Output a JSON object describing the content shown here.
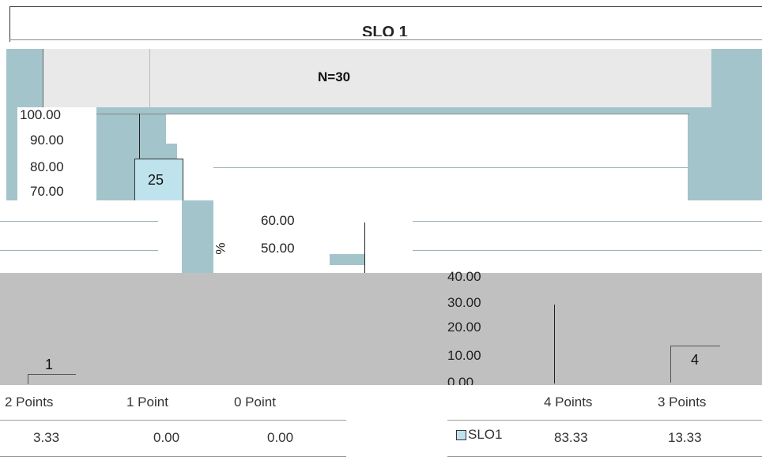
{
  "chart_data": {
    "type": "bar",
    "title": "SLO 1",
    "subtitle": "N=30",
    "ylabel": "%",
    "ylim": [
      0,
      100
    ],
    "y_ticks": [
      "100.00",
      "90.00",
      "80.00",
      "70.00",
      "60.00",
      "50.00",
      "40.00",
      "30.00",
      "20.00",
      "10.00",
      "0.00"
    ],
    "categories": [
      "4 Points",
      "3 Points",
      "2 Points",
      "1 Point",
      "0 Point"
    ],
    "series": [
      {
        "name": "SLO1",
        "values": [
          83.33,
          13.33,
          3.33,
          0.0,
          0.0
        ],
        "value_labels": [
          "83.33",
          "13.33",
          "3.33",
          "0.00",
          "0.00"
        ],
        "data_labels": [
          "25",
          "4",
          "1",
          "",
          ""
        ]
      }
    ],
    "grid": true,
    "legend": "table",
    "colors": {
      "bar": "#bfe3ec",
      "teal_band": "#a3c4cb",
      "gray_band": "#c0c0c0"
    }
  }
}
